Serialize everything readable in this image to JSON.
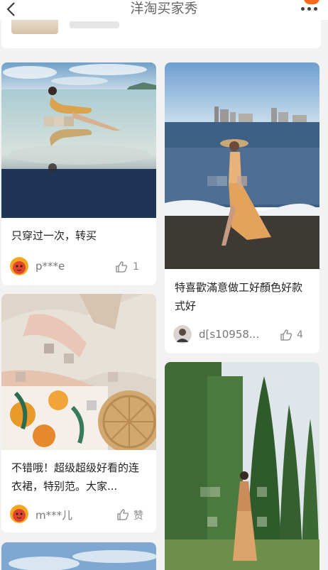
{
  "header": {
    "title": "洋淘买家秀",
    "back_icon": "chevron-left-icon",
    "more_icon": "more-dots-icon",
    "accent_color": "#ff6a1a"
  },
  "feed": {
    "cards": [
      {
        "caption": "只穿过一次，转买",
        "user": "p***e",
        "likes": "1",
        "avatar": "cartoon-avatar-icon",
        "image": "woman-seated-on-sandbar-reflection"
      },
      {
        "caption": "特喜歡滿意做工好顏色好款式好",
        "user": "d[s10958...",
        "likes": "4",
        "avatar": "user-photo-avatar",
        "image": "woman-walking-on-beach-in-dress"
      },
      {
        "caption": "不错哦！超级超级好看的连衣裙，特别范。大家...",
        "user": "m***儿",
        "likes": "赞",
        "avatar": "cartoon-avatar-icon",
        "image": "floral-dress-with-rattan-bag"
      },
      {
        "caption": "",
        "user": "",
        "likes": "",
        "avatar": "",
        "image": "woman-in-garden-between-cypress-trees"
      },
      {
        "caption": "",
        "user": "",
        "likes": "",
        "avatar": "",
        "image": "sky-partial"
      }
    ]
  }
}
